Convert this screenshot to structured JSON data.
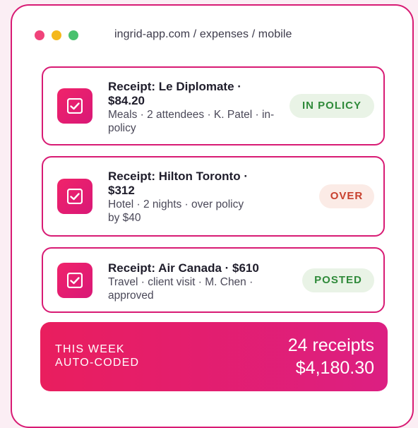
{
  "browser": {
    "url": "ingrid-app.com / expenses / mobile"
  },
  "receipts": [
    {
      "title_line1": "Receipt: Le Diplomate ·",
      "title_line2": "$84.20",
      "detail_line1": "Meals · 2 attendees · K. Patel · in-",
      "detail_line2": "policy",
      "status": "IN POLICY",
      "status_color": "#2f8a3a"
    },
    {
      "title_line1": "Receipt: Hilton Toronto ·",
      "title_line2": "$312",
      "detail_line1": "Hotel · 2 nights · over policy",
      "detail_line2": "by $40",
      "status": "OVER",
      "status_color": "#c8402e"
    },
    {
      "title_line1": "Receipt: Air Canada · $610",
      "detail_line1": "Travel · client visit · M. Chen ·",
      "detail_line2": "approved",
      "status": "POSTED",
      "status_color": "#2f8a3a"
    }
  ],
  "summary": {
    "label_line1": "THIS WEEK",
    "label_line2": "AUTO-CODED",
    "count": "24 receipts",
    "amount": "$4,180.30"
  },
  "icons": {
    "traffic_lights": [
      "close-dot",
      "minimize-dot",
      "maximize-dot"
    ],
    "receipt_icon": "checkbox-checked-icon"
  },
  "colors": {
    "accent": "#d81b74",
    "background": "#fbeef4"
  }
}
